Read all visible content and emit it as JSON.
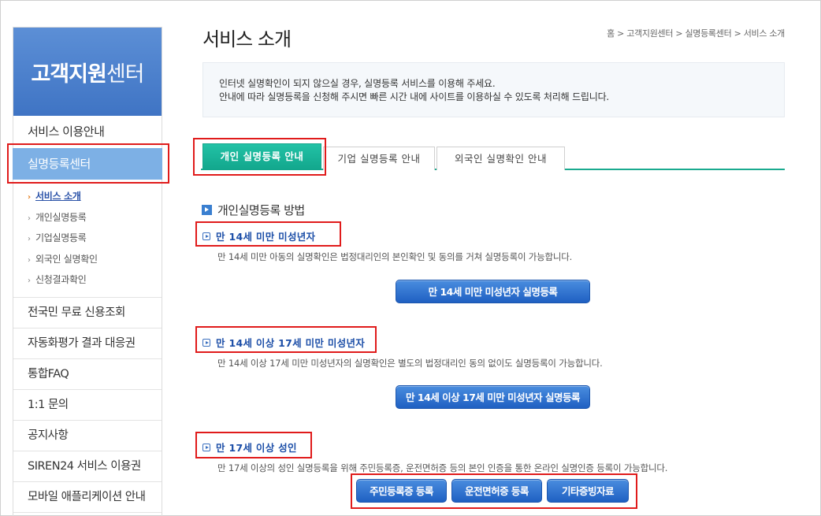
{
  "sidebar": {
    "banner_bold": "고객지원",
    "banner_light": "센터",
    "items": [
      {
        "label": "서비스 이용안내"
      },
      {
        "label": "실명등록센터"
      }
    ],
    "sub_items": [
      {
        "label": "서비스 소개"
      },
      {
        "label": "개인실명등록"
      },
      {
        "label": "기업실명등록"
      },
      {
        "label": "외국인 실명확인"
      },
      {
        "label": "신청결과확인"
      }
    ],
    "lower_items": [
      {
        "label": "전국민 무료 신용조회"
      },
      {
        "label": "자동화평가 결과 대응권"
      },
      {
        "label": "통합FAQ"
      },
      {
        "label": "1:1 문의"
      },
      {
        "label": "공지사항"
      },
      {
        "label": "SIREN24 서비스 이용권"
      },
      {
        "label": "모바일 애플리케이션 안내"
      }
    ],
    "sub_arrow": "›",
    "active_arrow": "›"
  },
  "header": {
    "title": "서비스 소개",
    "breadcrumb": "홈 > 고객지원센터 > 실명등록센터 > 서비스 소개"
  },
  "notice": {
    "line1": "인터넷 실명확인이 되지 않으실 경우, 실명등록 서비스를 이용해 주세요.",
    "line2": "안내에 따라 실명등록을 신청해 주시면 빠른 시간 내에 사이트를 이용하실 수 있도록 처리해 드립니다."
  },
  "tabs": [
    {
      "label": "개인 실명등록 안내"
    },
    {
      "label": "기업 실명등록 안내"
    },
    {
      "label": "외국인 실명확인 안내"
    }
  ],
  "section": {
    "title": "개인실명등록 방법",
    "groups": [
      {
        "heading": "만 14세 미만 미성년자",
        "description": "만 14세 미만 아동의 실명확인은 법정대리인의 본인확인 및 동의를 거쳐 실명등록이 가능합니다.",
        "button": "만 14세 미만 미성년자 실명등록"
      },
      {
        "heading": "만 14세 이상 17세 미만 미성년자",
        "description": "만 14세 이상 17세 미만 미성년자의 실명확인은 별도의 법정대리인 동의 없이도 실명등록이 가능합니다.",
        "button": "만 14세 이상 17세 미만 미성년자 실명등록"
      },
      {
        "heading": "만 17세 이상 성인",
        "description": "만 17세 이상의 성인 실명등록을 위해 주민등록증, 운전면허증 등의 본인 인증을 통한 온라인 실명인증 등록이 가능합니다.",
        "buttons": [
          "주민등록증 등록",
          "운전면허증 등록",
          "기타증빙자료"
        ]
      }
    ]
  },
  "colors": {
    "accent_teal": "#1aaa8f",
    "button_blue": "#1f60c2",
    "highlight_red": "#e01b1b",
    "sidebar_active": "#7db0e5"
  }
}
